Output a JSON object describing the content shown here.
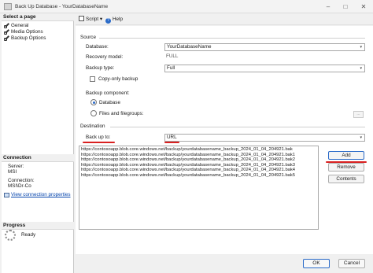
{
  "window": {
    "title": "Back Up Database - YourDatabaseName",
    "controls": {
      "minimize": "–",
      "maximize": "□",
      "close": "✕"
    }
  },
  "left": {
    "select_page_header": "Select a page",
    "pages": [
      {
        "label": "General"
      },
      {
        "label": "Media Options"
      },
      {
        "label": "Backup Options"
      }
    ],
    "connection_header": "Connection",
    "server_label": "Server:",
    "server_value": "MSI",
    "connection_label": "Connection:",
    "connection_value": "MSI\\Dr-Co",
    "view_properties_link": "View connection properties",
    "progress_header": "Progress",
    "progress_status": "Ready"
  },
  "toolbar": {
    "script_label": "Script",
    "script_dropdown": "▾",
    "help_label": "Help",
    "help_glyph": "?"
  },
  "source": {
    "section_label": "Source",
    "database_label": "Database:",
    "database_value": "YourDatabaseName",
    "recovery_label": "Recovery model:",
    "recovery_value": "FULL",
    "backup_type_label": "Backup type:",
    "backup_type_value": "Full",
    "copy_only_label": "Copy-only backup",
    "copy_only_checked": false,
    "component_label": "Backup component:",
    "component_database": "Database",
    "component_files": "Files and filegroups:",
    "component_selected": "Database",
    "ellipsis": "..."
  },
  "destination": {
    "section_label": "Destination",
    "backup_to_label": "Back up to:",
    "backup_to_value": "URL",
    "urls": [
      "https://contosoapp.blob.core.windows.net/backup/yourdatabasename_backup_2024_01_04_204921.bak",
      "https://contosoapp.blob.core.windows.net/backup/yourdatabasename_backup_2024_01_04_204921.bak1",
      "https://contosoapp.blob.core.windows.net/backup/yourdatabasename_backup_2024_01_04_204921.bak2",
      "https://contosoapp.blob.core.windows.net/backup/yourdatabasename_backup_2024_01_04_204921.bak3",
      "https://contosoapp.blob.core.windows.net/backup/yourdatabasename_backup_2024_01_04_204921.bak4",
      "https://contosoapp.blob.core.windows.net/backup/yourdatabasename_backup_2024_01_04_204921.bak5"
    ],
    "add_button": "Add",
    "remove_button": "Remove",
    "contents_button": "Contents"
  },
  "footer": {
    "ok_button": "OK",
    "cancel_button": "Cancel"
  },
  "colors": {
    "annotation_red": "#d92020",
    "accent_blue": "#2a6ac8"
  },
  "dropdown_arrow": "▾"
}
